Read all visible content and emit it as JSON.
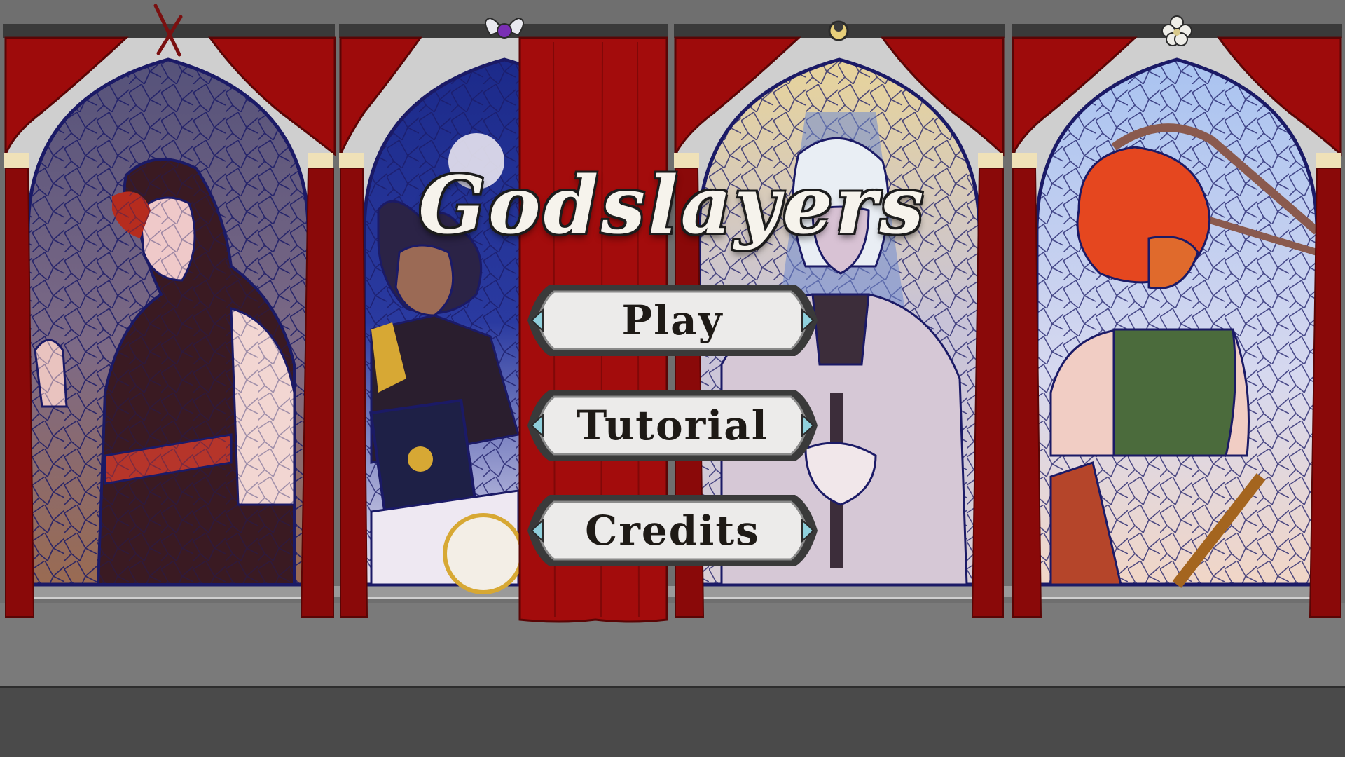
{
  "title": "Godslayers",
  "menu": {
    "play_label": "Play",
    "tutorial_label": "Tutorial",
    "credits_label": "Credits"
  },
  "colors": {
    "curtain": "#9e0b0b",
    "curtain_dark": "#6a0606",
    "wall": "#6f6f6f",
    "floor": "#4a4a4a",
    "frame": "#d5d5d5",
    "lead": "#1b1a66",
    "button_face": "#ecebea",
    "button_border": "#3a3a3a"
  },
  "icons": [
    "crossed-swords-icon",
    "winged-orb-icon",
    "moon-ring-icon",
    "flower-icon"
  ]
}
